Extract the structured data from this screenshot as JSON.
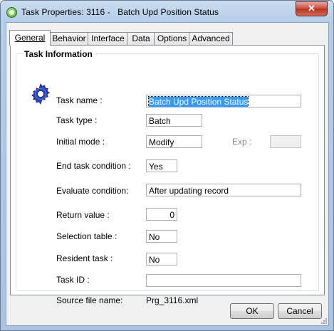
{
  "window": {
    "title": "Task Properties: 3116 -   Batch Upd Position Status",
    "close_label": "✕"
  },
  "tabs": [
    {
      "label": "General",
      "active": true
    },
    {
      "label": "Behavior",
      "active": false
    },
    {
      "label": "Interface",
      "active": false
    },
    {
      "label": "Data",
      "active": false
    },
    {
      "label": "Options",
      "active": false
    },
    {
      "label": "Advanced",
      "active": false
    }
  ],
  "task_info": {
    "group_title": "Task Information",
    "task_name_label": "Task name :",
    "task_name_value": "Batch Upd Position Status",
    "task_type_label": "Task type :",
    "task_type_value": "Batch",
    "initial_mode_label": "Initial mode :",
    "initial_mode_value": "Modify",
    "exp_label": "Exp :",
    "exp_value": "",
    "end_task_label": "End task condition :",
    "end_task_value": "Yes",
    "evaluate_label": "Evaluate condition:",
    "evaluate_value": "After updating record",
    "return_label": "Return value :",
    "return_value": "0",
    "selection_label": "Selection table :",
    "selection_value": "No",
    "resident_label": "Resident task :",
    "resident_value": "No",
    "task_id_label": "Task ID :",
    "task_id_value": "",
    "source_label": "Source file name:",
    "source_value": "Prg_3116.xml"
  },
  "buttons": {
    "ok": "OK",
    "cancel": "Cancel"
  },
  "icons": {
    "app": "app-icon",
    "gear": "gear-icon",
    "close": "close-icon",
    "grip": "resize-grip-icon"
  },
  "colors": {
    "selection": "#3399ff",
    "gear": "#2a45b8"
  }
}
